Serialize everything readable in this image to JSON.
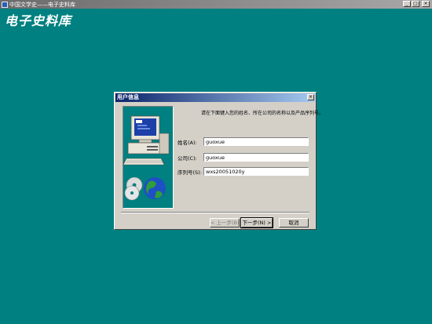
{
  "window": {
    "title": "中国文学史——电子史料库",
    "minimize": "_",
    "maximize": "□",
    "close": "×"
  },
  "brand": "电子史料库",
  "dialog": {
    "title": "用户信息",
    "close": "×",
    "prompt": "请在下面键入您的姓名、所在公司的名称以及产品序列号。",
    "fields": {
      "name": {
        "label": "姓名(A):",
        "value": "guoxue"
      },
      "company": {
        "label": "公司(C):",
        "value": "guoxue"
      },
      "serial": {
        "label": "序列号(S):",
        "value": "wxs20051020y"
      }
    },
    "buttons": {
      "back": "< 上一步(B)",
      "next": "下一步(N) >",
      "cancel": "取消"
    }
  },
  "colors": {
    "desktop": "#008080",
    "dialog_title_start": "#0a246a",
    "dialog_title_end": "#a6caf0"
  },
  "icons": [
    "application-icon",
    "computer-icon",
    "globe-cd-icon"
  ]
}
